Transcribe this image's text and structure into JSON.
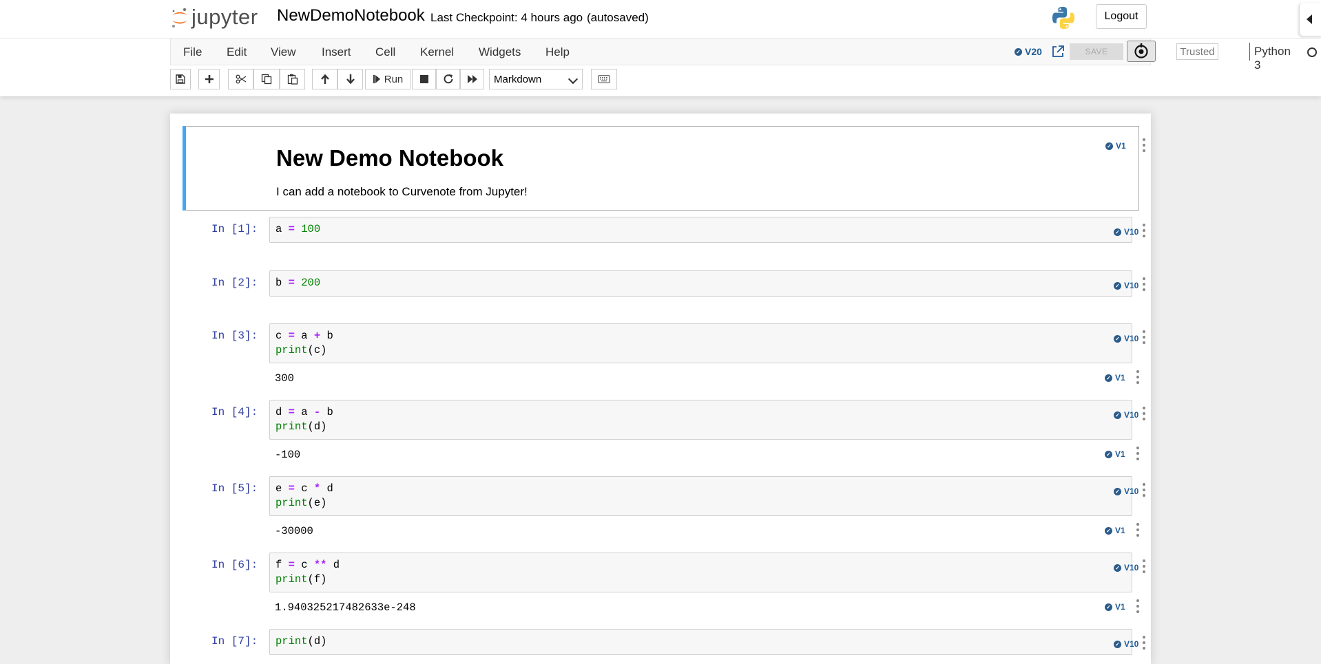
{
  "header": {
    "logo_text": "jupyter",
    "notebook_name": "NewDemoNotebook",
    "checkpoint": "Last Checkpoint: 4 hours ago",
    "autosave": "(autosaved)",
    "logout": "Logout"
  },
  "menu": {
    "items": [
      "File",
      "Edit",
      "View",
      "Insert",
      "Cell",
      "Kernel",
      "Widgets",
      "Help"
    ],
    "version_badge": "V20",
    "save": "SAVE",
    "trusted": "Trusted",
    "kernel": "Python 3"
  },
  "toolbar": {
    "run_label": "Run",
    "cell_type": "Markdown"
  },
  "markdown_cell": {
    "title": "New Demo Notebook",
    "text": "I can add a notebook to Curvenote from Jupyter!",
    "version": "V1"
  },
  "cells": [
    {
      "prompt": "In [1]:",
      "lines": [
        "a = 100"
      ],
      "version": "V10",
      "output": null,
      "output_version": null
    },
    {
      "prompt": "In [2]:",
      "lines": [
        "b = 200"
      ],
      "version": "V10",
      "output": null,
      "output_version": null
    },
    {
      "prompt": "In [3]:",
      "lines": [
        "c = a + b",
        "print(c)"
      ],
      "version": "V10",
      "output": "300",
      "output_version": "V1"
    },
    {
      "prompt": "In [4]:",
      "lines": [
        "d = a - b",
        "print(d)"
      ],
      "version": "V10",
      "output": "-100",
      "output_version": "V1"
    },
    {
      "prompt": "In [5]:",
      "lines": [
        "e = c * d",
        "print(e)"
      ],
      "version": "V10",
      "output": "-30000",
      "output_version": "V1"
    },
    {
      "prompt": "In [6]:",
      "lines": [
        "f = c ** d",
        "print(f)"
      ],
      "version": "V10",
      "output": "1.940325217482633e-248",
      "output_version": "V1"
    },
    {
      "prompt": "In [7]:",
      "lines": [
        "print(d)"
      ],
      "version": "V10",
      "output": null,
      "output_version": null
    }
  ],
  "colors": {
    "accent": "#42a5f5",
    "prompt": "#303f9f",
    "badge": "#1f5c99",
    "operator": "#aa22ff",
    "number": "#008000"
  }
}
